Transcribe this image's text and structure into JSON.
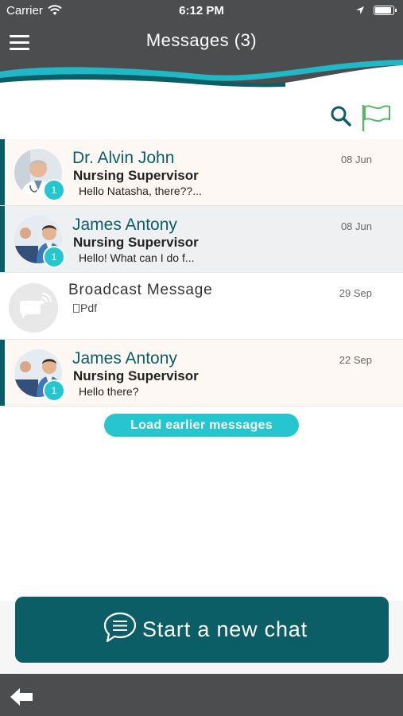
{
  "status_bar": {
    "carrier": "Carrier",
    "time": "6:12 PM",
    "battery_level": 1.0
  },
  "header": {
    "title": "Messages (3)"
  },
  "colors": {
    "accent": "#0b5e66",
    "badge": "#26c6d0",
    "bar": "#4c4d4f"
  },
  "conversations": [
    {
      "name": "Dr. Alvin John",
      "role": "Nursing Supervisor",
      "preview": "Hello Natasha, there??...",
      "date": "08 Jun",
      "unread_count": "1"
    },
    {
      "name": "James Antony",
      "role": "Nursing Supervisor",
      "preview": "Hello! What can I do f...",
      "date": "08 Jun",
      "unread_count": "1"
    },
    {
      "name": "Broadcast Message",
      "attachment": "Pdf",
      "date": "29 Sep"
    },
    {
      "name": "James Antony",
      "role": "Nursing Supervisor",
      "preview": "Hello there?",
      "date": "22 Sep",
      "unread_count": "1"
    }
  ],
  "load_earlier": "Load earlier messages",
  "new_chat": "Start a new chat"
}
